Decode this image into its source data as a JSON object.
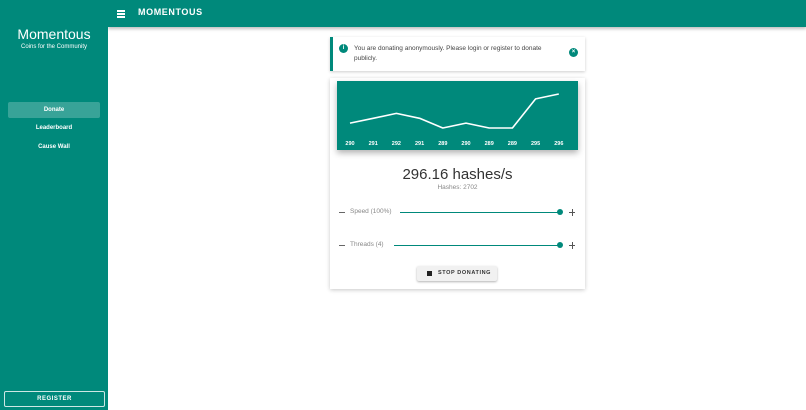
{
  "app": {
    "brand": "Momentous",
    "tagline": "Coins for the Community",
    "topbar_title": "MOMENTOUS"
  },
  "sidebar": {
    "items": [
      {
        "label": "Donate",
        "active": true
      },
      {
        "label": "Leaderboard",
        "active": false
      },
      {
        "label": "Cause Wall",
        "active": false
      }
    ],
    "register_label": "REGISTER"
  },
  "alert": {
    "text": "You are donating anonymously. Please login or register to donate publicly.",
    "icon": "info-icon",
    "close_icon": "close-circle-icon"
  },
  "stats": {
    "rate": "296.16 hashes/s",
    "hashes": "Hashes: 2702"
  },
  "controls": {
    "speed_label": "Speed (100%)",
    "speed_percent": 100,
    "threads_label": "Threads (4)",
    "threads_fraction": 1.0,
    "stop_label": "STOP DONATING"
  },
  "chart_data": {
    "type": "line",
    "x_tick_labels": [
      "290",
      "291",
      "292",
      "291",
      "289",
      "290",
      "289",
      "289",
      "295",
      "296"
    ],
    "values": [
      290,
      291,
      292,
      291,
      289,
      290,
      289,
      289,
      295,
      296
    ],
    "title": "",
    "xlabel": "",
    "ylabel": "",
    "grid": false,
    "line_color": "#ffffff",
    "background": "#00897b"
  },
  "colors": {
    "accent": "#00897b"
  }
}
